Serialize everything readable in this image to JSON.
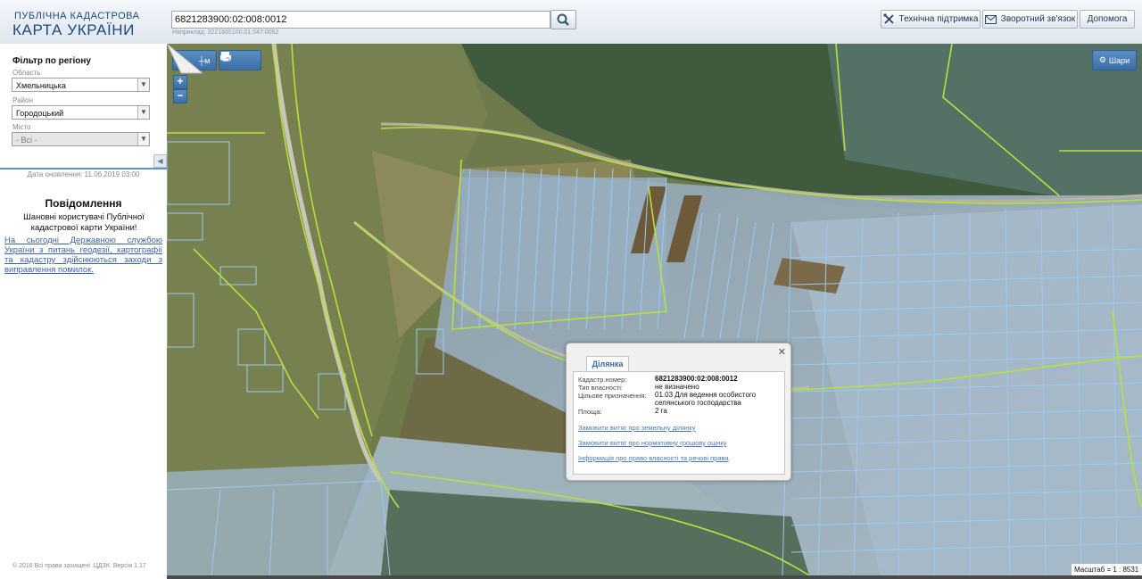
{
  "header": {
    "logo_top": "ПУБЛІЧНА КАДАСТРОВА",
    "logo_main": "КАРТА УКРАЇНИ",
    "search_value": "6821283900:02:008:0012",
    "search_hint": "Наприклад: 3221655100:01:047:0052",
    "buttons": {
      "support": "Технічна підтримка",
      "feedback": "Зворотний зв'язок",
      "help": "Допомога"
    }
  },
  "sidebar": {
    "filter_title": "Фільтр по регіону",
    "region_label": "Область",
    "region_value": "Хмельницька",
    "district_label": "Район",
    "district_value": "Городоцький",
    "city_label": "Місто",
    "city_value": "- Всі -",
    "update_date": "Дата оновлення: 11.06.2019 03:00",
    "notice_title": "Повідомлення",
    "notice_text": "Шановні користувачі Публічної кадастрової карти України!",
    "notice_link": "На сьогодні Державною службою України з питань геодезії, картографії та кадастру здійснюються заходи з виправлення помилок.",
    "copyright": "© 2016 Всі права захищені. ЦДЗК. Версія 1.17"
  },
  "map": {
    "toolbar": {
      "ruler": "|м",
      "area": "┼м",
      "print": "print-icon",
      "info": "info-cursor-icon"
    },
    "zoom_in": "+",
    "zoom_out": "−",
    "layers_label": "Шари",
    "scale_text": "Масштаб = 1 : 8531",
    "popup": {
      "tab": "Ділянка",
      "fields": [
        {
          "label": "Кадастр.номер:",
          "value": "6821283900:02:008:0012"
        },
        {
          "label": "Тип власності:",
          "value": "не визначено"
        },
        {
          "label": "Цільове призначення:",
          "value": "01.03 Для ведення особистого селянського господарства"
        },
        {
          "label": "Площа:",
          "value": "2 га"
        }
      ],
      "links": [
        "Замовити витяг про земельну ділянку",
        "Замовити витяг про нормативну грошову оцінку",
        "Інформація про право власності та речові права"
      ]
    },
    "colors": {
      "parcel_outline": "#9ccbf0",
      "boundary_green": "#b8e03a",
      "parcel_fill": "#c8dff3",
      "button_blue": "#4779b0"
    }
  }
}
